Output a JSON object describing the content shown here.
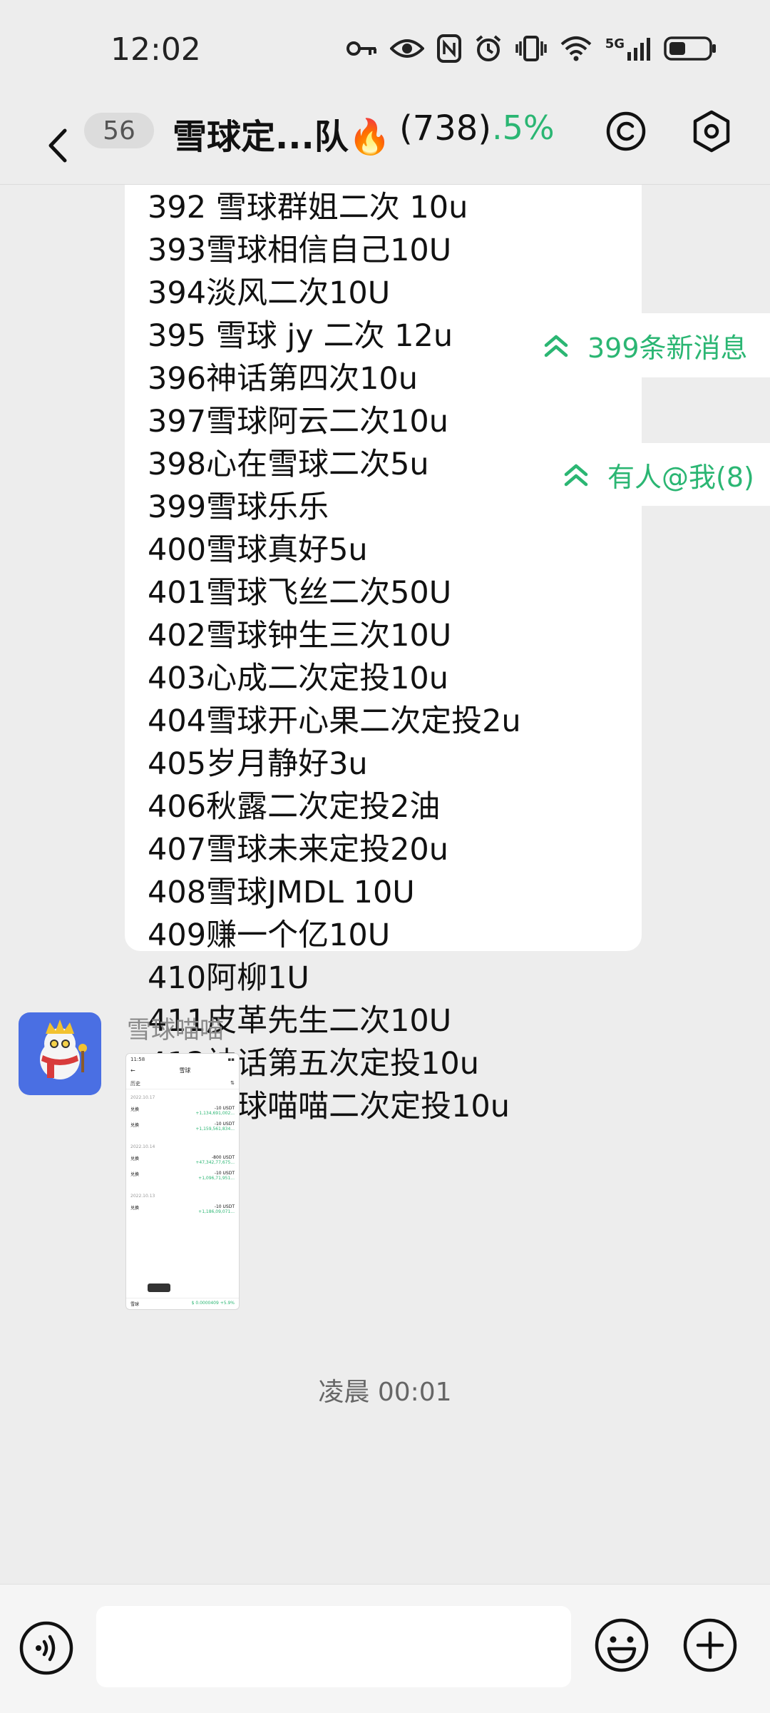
{
  "status_bar": {
    "time": "12:02",
    "network": "5G"
  },
  "header": {
    "unread_count": "56",
    "title": "雪球定...队🔥",
    "member_count": "(738)",
    "percent": ".5%",
    "accent_color": "#2bb673"
  },
  "message": {
    "lines": [
      "392 雪球群姐二次 10u",
      "393雪球相信自己10U",
      "394淡风二次10U",
      "395 雪球 jy 二次 12u",
      "396神话第四次10u",
      "397雪球阿云二次10u",
      "398心在雪球二次5u",
      "399雪球乐乐",
      "400雪球真好5u",
      "401雪球飞丝二次50U",
      "402雪球钟生三次10U",
      "403心成二次定投10u",
      "404雪球开心果二次定投2u",
      "405岁月静好3u",
      "406秋露二次定投2油",
      "407雪球未来定投20u",
      "408雪球JMDL 10U",
      "409赚一个亿10U",
      "410阿柳1U",
      "411皮革先生二次10U",
      "412神话第五次定投10u",
      "413雪球喵喵二次定投10u"
    ]
  },
  "new_messages_pill": {
    "label": "399条新消息"
  },
  "mention_pill": {
    "label": "有人@我(8)"
  },
  "image_message": {
    "sender": "雪球喵喵",
    "thumb": {
      "time": "11:58",
      "title": "雪球",
      "section": "历史",
      "dates": [
        "2022.10.17",
        "2022.10.14",
        "2022.10.13"
      ],
      "rows": [
        {
          "label": "兑换",
          "amount": "-10 USDT",
          "sub": "+1,134,691,002..."
        },
        {
          "label": "兑换",
          "amount": "-10 USDT",
          "sub": "+1,159,561,834..."
        },
        {
          "label": "兑换",
          "amount": "-800 USDT",
          "sub": "+47,342,77,675..."
        },
        {
          "label": "兑换",
          "amount": "-10 USDT",
          "sub": "+1,096,71,951..."
        },
        {
          "label": "兑换",
          "amount": "-10 USDT",
          "sub": "+1,186,09,071..."
        }
      ],
      "footer_left": "雪球",
      "footer_right": "$ 0.0000409 +5.9%"
    }
  },
  "timestamp": "凌晨 00:01"
}
